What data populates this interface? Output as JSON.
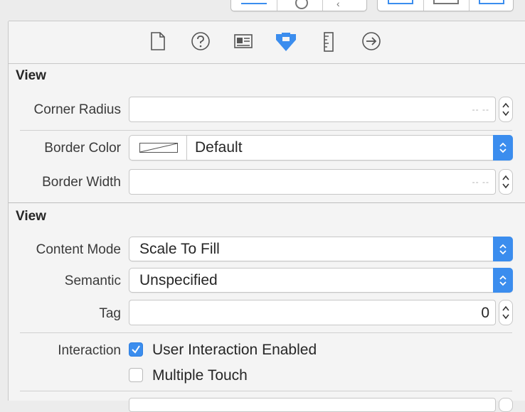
{
  "inspector_tabs": [
    {
      "name": "file-inspector",
      "icon": "document-icon"
    },
    {
      "name": "quick-help",
      "icon": "question-icon"
    },
    {
      "name": "identity-inspector",
      "icon": "identity-card-icon"
    },
    {
      "name": "attributes-inspector",
      "icon": "attributes-arrow-icon",
      "selected": true
    },
    {
      "name": "size-inspector",
      "icon": "ruler-icon"
    },
    {
      "name": "connections-inspector",
      "icon": "arrow-circle-icon"
    }
  ],
  "section1": {
    "title": "View",
    "corner_radius": {
      "label": "Corner Radius",
      "placeholder": "-- --",
      "value": ""
    },
    "border_color": {
      "label": "Border Color",
      "value": "Default"
    },
    "border_width": {
      "label": "Border Width",
      "placeholder": "-- --",
      "value": ""
    }
  },
  "section2": {
    "title": "View",
    "content_mode": {
      "label": "Content Mode",
      "value": "Scale To Fill"
    },
    "semantic": {
      "label": "Semantic",
      "value": "Unspecified"
    },
    "tag": {
      "label": "Tag",
      "value": "0"
    },
    "interaction": {
      "label": "Interaction",
      "options": [
        {
          "label": "User Interaction Enabled",
          "checked": true
        },
        {
          "label": "Multiple Touch",
          "checked": false
        }
      ]
    }
  },
  "colors": {
    "accent": "#3b8dee"
  }
}
